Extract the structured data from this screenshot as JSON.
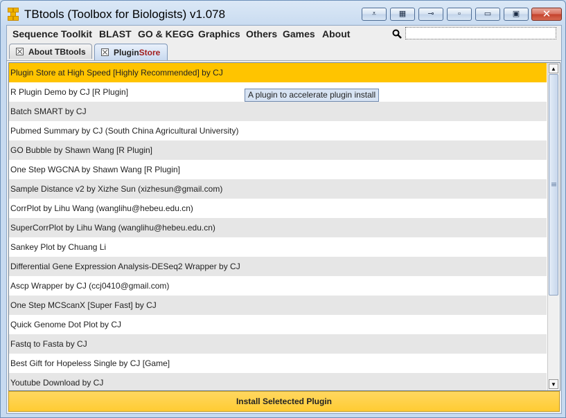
{
  "window": {
    "title": "TBtools (Toolbox for Biologists) v1.078",
    "controls": [
      {
        "name": "collapse-button",
        "glyph": "⩡"
      },
      {
        "name": "keyboard-button",
        "glyph": "▦"
      },
      {
        "name": "pin-button",
        "glyph": "⊸"
      },
      {
        "name": "minimize-small-button",
        "glyph": "▫"
      },
      {
        "name": "minimize-button",
        "glyph": "▭"
      },
      {
        "name": "maximize-button",
        "glyph": "▣"
      },
      {
        "name": "close-button",
        "glyph": "✕"
      }
    ]
  },
  "menu": {
    "items": [
      "Sequence Toolkit",
      "BLAST",
      "GO & KEGG",
      "Graphics",
      "Others",
      "Games",
      "About"
    ]
  },
  "search": {
    "value": "",
    "placeholder": ""
  },
  "tabs": [
    {
      "label": "About TBtools",
      "label_accent": "",
      "active": false
    },
    {
      "label": "Plugin ",
      "label_accent": "Store",
      "active": true
    }
  ],
  "plugin_list": {
    "selected_index": 0,
    "items": [
      "Plugin Store at High Speed [Highly Recommended] by CJ",
      "R Plugin Demo by CJ [R Plugin]",
      "Batch SMART by CJ",
      "Pubmed Summary by CJ (South China Agricultural University)",
      "GO Bubble by Shawn Wang [R Plugin]",
      "One Step WGCNA by Shawn Wang [R Plugin]",
      "Sample Distance v2 by Xizhe Sun (xizhesun@gmail.com)",
      "CorrPlot by Lihu Wang (wanglihu@hebeu.edu.cn)",
      "SuperCorrPlot by Lihu Wang (wanglihu@hebeu.edu.cn)",
      "Sankey Plot by Chuang Li",
      "Differential Gene Expression Analysis-DESeq2 Wrapper by CJ",
      "Ascp Wrapper by CJ (ccj0410@gmail.com)",
      "One Step MCScanX [Super Fast] by CJ",
      "Quick Genome Dot Plot by CJ",
      "Fastq to Fasta by CJ",
      "Best Gift for Hopeless Single by CJ [Game]",
      "Youtube Download by CJ"
    ]
  },
  "tooltip": {
    "text": "A plugin to accelerate plugin install"
  },
  "install_button": {
    "label": "Install Seletected Plugin"
  },
  "colors": {
    "selected_row": "#ffc400",
    "install_button": "#ffcc33",
    "tab_accent": "#a11d1d"
  }
}
